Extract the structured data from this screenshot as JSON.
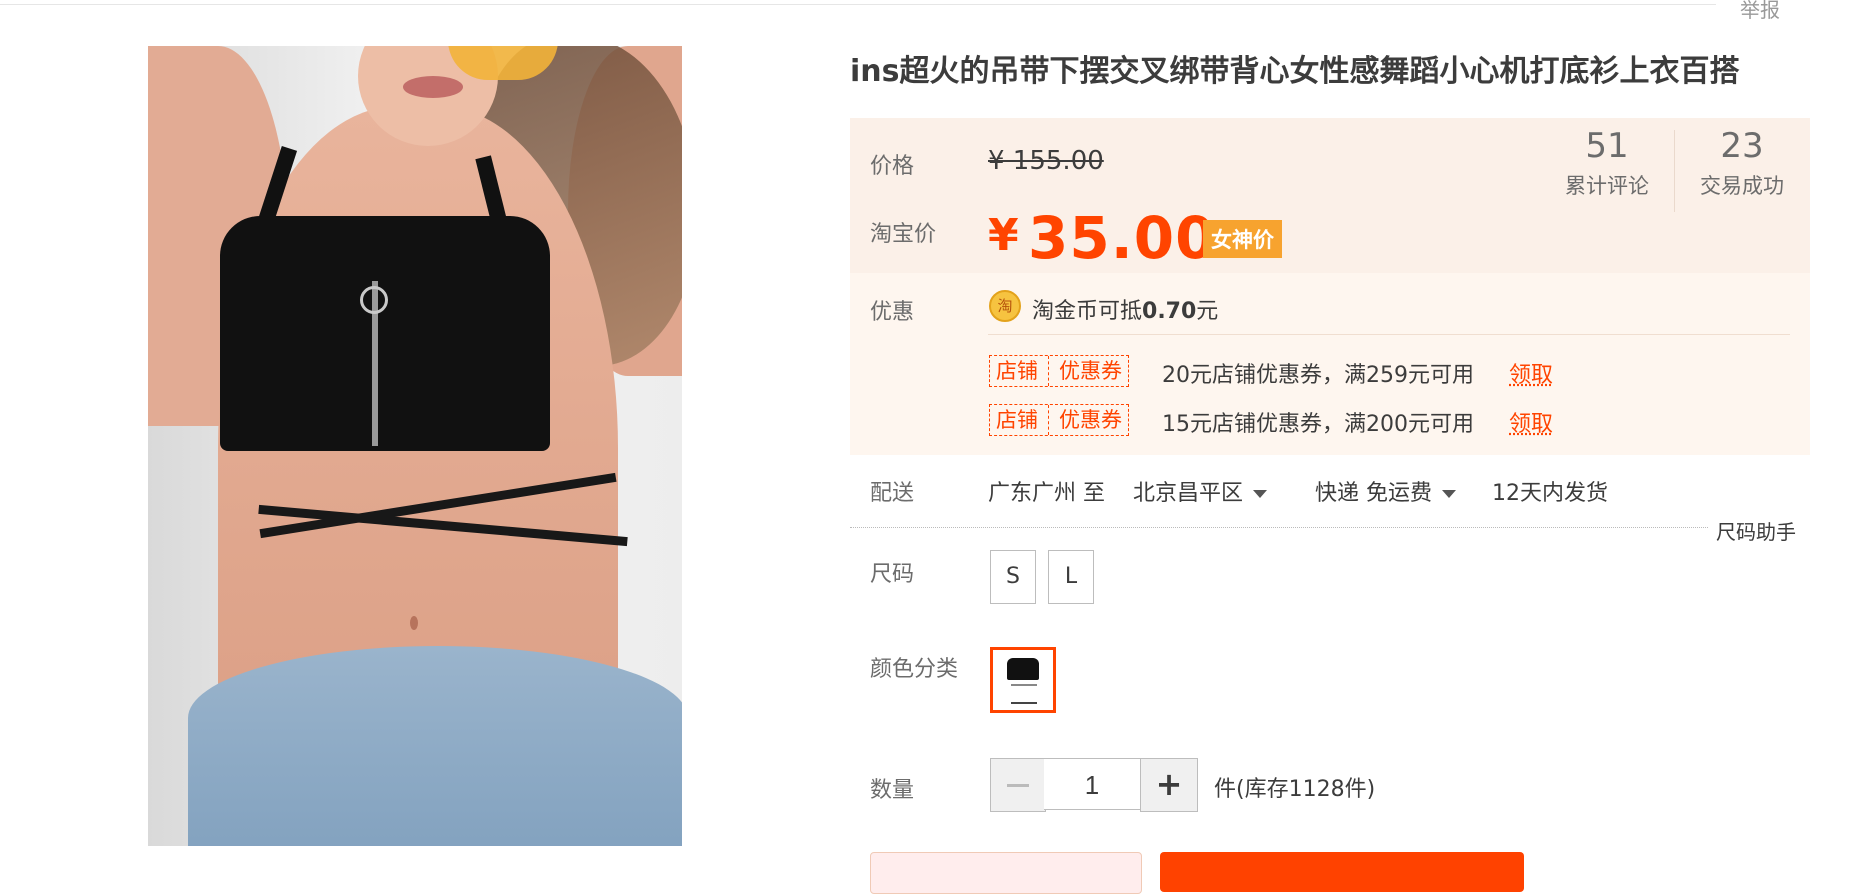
{
  "header": {
    "report_label": "举报"
  },
  "product": {
    "title": "ins超火的吊带下摆交叉绑带背心女性感舞蹈小心机打底衫上衣百搭",
    "image_alt": "black crop top with cross straps"
  },
  "price": {
    "label": "价格",
    "original": "¥ 155.00",
    "taobao_label": "淘宝价",
    "currency": "¥",
    "current": "35.00",
    "badge": "女神价"
  },
  "stats": [
    {
      "number": "51",
      "label": "累计评论"
    },
    {
      "number": "23",
      "label": "交易成功"
    }
  ],
  "promo": {
    "label": "优惠",
    "coin_icon": "淘",
    "coin_text_prefix": "淘金币可抵",
    "coin_amount": "0.70",
    "coin_text_suffix": "元",
    "coupons": [
      {
        "tag_left": "店铺",
        "tag_right": "优惠券",
        "desc": "20元店铺优惠券，满259元可用",
        "action": "领取"
      },
      {
        "tag_left": "店铺",
        "tag_right": "优惠券",
        "desc": "15元店铺优惠券，满200元可用",
        "action": "领取"
      }
    ]
  },
  "shipping": {
    "label": "配送",
    "from": "广东广州",
    "to_word": "至",
    "destination": "北京昌平区",
    "method": "快递 免运费",
    "eta": "12天内发货",
    "size_helper": "尺码助手"
  },
  "size": {
    "label": "尺码",
    "options": [
      "S",
      "L"
    ]
  },
  "color": {
    "label": "颜色分类"
  },
  "quantity": {
    "label": "数量",
    "value": "1",
    "plus": "+",
    "stock": "件(库存1128件)"
  },
  "colors": {
    "accent": "#ff4400",
    "price_bg": "#fbf0e8",
    "promo_bg": "#fef6ef",
    "badge": "#f7a32f"
  }
}
